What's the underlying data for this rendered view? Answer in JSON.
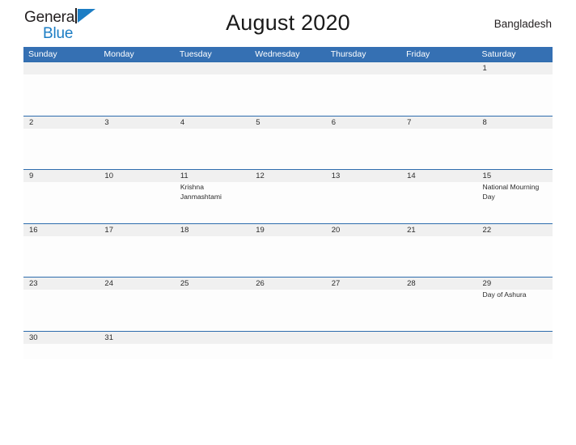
{
  "brand": {
    "name_dark": "General",
    "name_blue": "Blue",
    "accent_color": "#1c7dc4"
  },
  "header": {
    "title": "August 2020",
    "country": "Bangladesh",
    "header_bar_color": "#3570b3",
    "number_band_color": "#f0f0f0"
  },
  "weekdays": [
    "Sunday",
    "Monday",
    "Tuesday",
    "Wednesday",
    "Thursday",
    "Friday",
    "Saturday"
  ],
  "weeks": [
    {
      "days": [
        {
          "num": "",
          "event": ""
        },
        {
          "num": "",
          "event": ""
        },
        {
          "num": "",
          "event": ""
        },
        {
          "num": "",
          "event": ""
        },
        {
          "num": "",
          "event": ""
        },
        {
          "num": "",
          "event": ""
        },
        {
          "num": "1",
          "event": ""
        }
      ]
    },
    {
      "days": [
        {
          "num": "2",
          "event": ""
        },
        {
          "num": "3",
          "event": ""
        },
        {
          "num": "4",
          "event": ""
        },
        {
          "num": "5",
          "event": ""
        },
        {
          "num": "6",
          "event": ""
        },
        {
          "num": "7",
          "event": ""
        },
        {
          "num": "8",
          "event": ""
        }
      ]
    },
    {
      "days": [
        {
          "num": "9",
          "event": ""
        },
        {
          "num": "10",
          "event": ""
        },
        {
          "num": "11",
          "event": "Krishna Janmashtami"
        },
        {
          "num": "12",
          "event": ""
        },
        {
          "num": "13",
          "event": ""
        },
        {
          "num": "14",
          "event": ""
        },
        {
          "num": "15",
          "event": "National Mourning Day"
        }
      ]
    },
    {
      "days": [
        {
          "num": "16",
          "event": ""
        },
        {
          "num": "17",
          "event": ""
        },
        {
          "num": "18",
          "event": ""
        },
        {
          "num": "19",
          "event": ""
        },
        {
          "num": "20",
          "event": ""
        },
        {
          "num": "21",
          "event": ""
        },
        {
          "num": "22",
          "event": ""
        }
      ]
    },
    {
      "days": [
        {
          "num": "23",
          "event": ""
        },
        {
          "num": "24",
          "event": ""
        },
        {
          "num": "25",
          "event": ""
        },
        {
          "num": "26",
          "event": ""
        },
        {
          "num": "27",
          "event": ""
        },
        {
          "num": "28",
          "event": ""
        },
        {
          "num": "29",
          "event": "Day of Ashura"
        }
      ]
    },
    {
      "days": [
        {
          "num": "30",
          "event": ""
        },
        {
          "num": "31",
          "event": ""
        },
        {
          "num": "",
          "event": ""
        },
        {
          "num": "",
          "event": ""
        },
        {
          "num": "",
          "event": ""
        },
        {
          "num": "",
          "event": ""
        },
        {
          "num": "",
          "event": ""
        }
      ]
    }
  ]
}
